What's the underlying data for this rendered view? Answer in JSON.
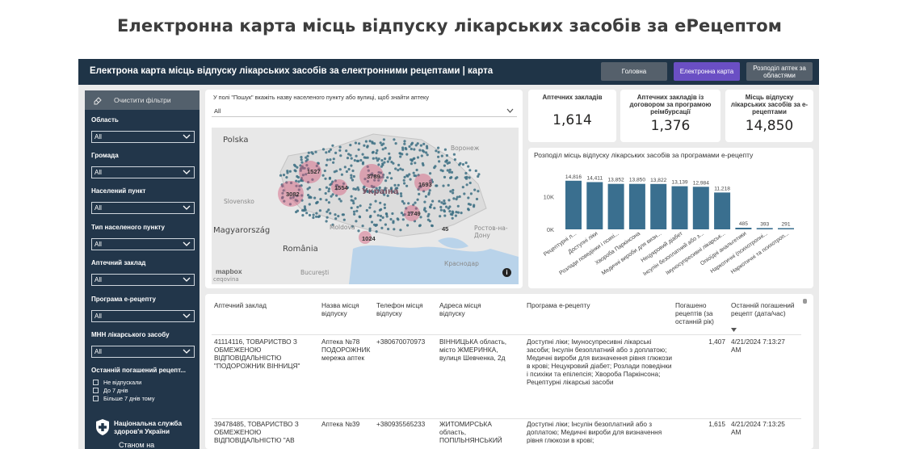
{
  "page_title": "Електронна карта місць відпуску лікарських засобів за еРецептом",
  "report": {
    "title": "Електрона карта місць відпуску лікарських засобів за електронними рецептами | карта",
    "nav": {
      "home": "Головна",
      "map": "Електронна карта",
      "distribution": "Розподіл аптек за областями"
    }
  },
  "sidebar": {
    "clear_filters": "Очистити фільтри",
    "filters": [
      {
        "label": "Область",
        "value": "All"
      },
      {
        "label": "Громада",
        "value": "All"
      },
      {
        "label": "Населений пункт",
        "value": "All"
      },
      {
        "label": "Тип населеного пункту",
        "value": "All"
      },
      {
        "label": "Аптечний заклад",
        "value": "All"
      },
      {
        "label": "Програма е-рецепту",
        "value": "All"
      },
      {
        "label": "МНН лікарського засобу",
        "value": "All"
      }
    ],
    "last_recipe": {
      "label": "Останній погашений рецепт...",
      "options": [
        "Не відпускали",
        "До 7 днів",
        "Більше 7 днів тому"
      ]
    },
    "org": "Національна служба здоров'я України",
    "as_of": "Станом на"
  },
  "map_panel": {
    "hint": "У полі \"Пошук\" вкажіть назву населеного пункту або вулиці, щоб знайти аптеку",
    "search_value": "All",
    "labels": {
      "poland": "Polska",
      "ukraine": "Україна",
      "slovakia": "Slovensko",
      "hungary": "Magyarország",
      "romania": "România",
      "moldova": "Moldova",
      "bucharest": "Bucureşti",
      "voronezh": "Воронеж",
      "krasnodar": "Краснодар",
      "rostov": "Ростов-на-Дону",
      "mapbox": "mapbox",
      "credit": "ceqovina",
      "info": "i"
    },
    "clusters": [
      "1527",
      "3082",
      "1554",
      "3789",
      "1693",
      "1749",
      "1024",
      "45"
    ]
  },
  "kpis": [
    {
      "label": "Аптечних закладів",
      "value": "1,614"
    },
    {
      "label": "Аптечних закладів із договором за програмою реімбурсації",
      "value": "1,376"
    },
    {
      "label": "Місць відпуску лікарських засобів за е-рецептами",
      "value": "14,850"
    }
  ],
  "chart_data": {
    "type": "bar",
    "title": "Розподіл місць відпуску лікарських засобів за програмами е-рецепту",
    "categories": [
      "Рецептурні л...",
      "Доступні ліки",
      "Розлади поведінки і психі...",
      "Хвороба Паркінсона",
      "Медичні вироби для визн...",
      "Нецукровий діабет",
      "Інсулін безоплатний або з...",
      "Імуносупресивні лікарськ...",
      "Опіоїдні анальгетики",
      "Наркотичні (психотропні...",
      "Наркотичні та психотроп..."
    ],
    "values": [
      14816,
      14411,
      13852,
      13850,
      13822,
      13139,
      12984,
      11218,
      485,
      393,
      291
    ],
    "data_labels": [
      "14,816",
      "14,411",
      "13,852",
      "13,850",
      "13,822",
      "13,139",
      "12,984",
      "11,218",
      "485",
      "393",
      "291"
    ],
    "y_ticks": [
      "10K",
      "0K"
    ],
    "ylim": [
      0,
      16000
    ],
    "color": "#3a6f8f"
  },
  "table": {
    "headers": [
      "Аптечний заклад",
      "Назва місця відпуску",
      "Телефон місця відпуску",
      "Адреса місця відпуску",
      "Програма е-рецепту",
      "Погашено рецептів (за останній рік)",
      "Останній погашений рецепт (дата/час)"
    ],
    "rows": [
      {
        "pharmacy": "41114116, ТОВАРИСТВО З ОБМЕЖЕНОЮ ВІДПОВІДАЛЬНІСТЮ \"ПОДОРОЖНИК ВІННИЦЯ\"",
        "place": "Аптека №78 ПОДОРОЖНИК мережа аптек",
        "phone": "+380670070973",
        "address": "ВІННИЦЬКА область, місто ЖМЕРИНКА, вулиця Шевченка, 2д",
        "program": "Доступні ліки; Імуносупресивні лікарські засоби; Інсулін безоплатний або з доплатою; Медичні вироби для визначення рівня глюкози в крові; Нецукровий діабет; Розлади поведінки і психіки та епілепсія; Хвороба Паркінсона; Рецептурні лікарські засоби",
        "count": "1,407",
        "last": "4/21/2024 7:13:27 AM"
      },
      {
        "pharmacy": "39478485, ТОВАРИСТВО З ОБМЕЖЕНОЮ ВІДПОВІДАЛЬНІСТЮ \"АВ",
        "place": "Аптека №39",
        "phone": "+380935565233",
        "address": "ЖИТОМИРСЬКА область, ПОПІЛЬНЯНСЬКИЙ",
        "program": "Доступні ліки; Інсулін безоплатний або з доплатою; Медичні вироби для визначення рівня глюкози в крові;",
        "count": "1,615",
        "last": "4/21/2024 7:13:25 AM"
      }
    ]
  }
}
